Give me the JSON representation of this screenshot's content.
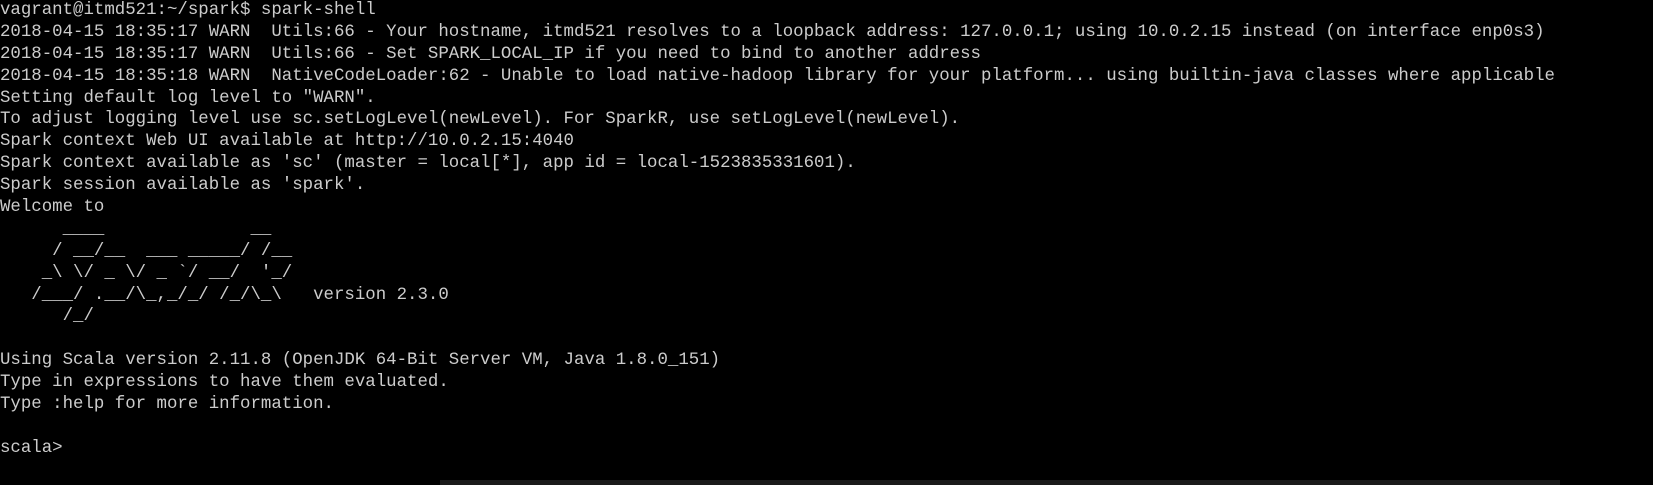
{
  "terminal": {
    "lines": [
      "vagrant@itmd521:~/spark$ spark-shell",
      "2018-04-15 18:35:17 WARN  Utils:66 - Your hostname, itmd521 resolves to a loopback address: 127.0.0.1; using 10.0.2.15 instead (on interface enp0s3)",
      "2018-04-15 18:35:17 WARN  Utils:66 - Set SPARK_LOCAL_IP if you need to bind to another address",
      "2018-04-15 18:35:18 WARN  NativeCodeLoader:62 - Unable to load native-hadoop library for your platform... using builtin-java classes where applicable",
      "Setting default log level to \"WARN\".",
      "To adjust logging level use sc.setLogLevel(newLevel). For SparkR, use setLogLevel(newLevel).",
      "Spark context Web UI available at http://10.0.2.15:4040",
      "Spark context available as 'sc' (master = local[*], app id = local-1523835331601).",
      "Spark session available as 'spark'.",
      "Welcome to",
      "      ____              __",
      "     / __/__  ___ _____/ /__",
      "    _\\ \\/ _ \\/ _ `/ __/  '_/",
      "   /___/ .__/\\_,_/_/ /_/\\_\\   version 2.3.0",
      "      /_/",
      "",
      "Using Scala version 2.11.8 (OpenJDK 64-Bit Server VM, Java 1.8.0_151)",
      "Type in expressions to have them evaluated.",
      "Type :help for more information.",
      "",
      "scala> "
    ]
  }
}
